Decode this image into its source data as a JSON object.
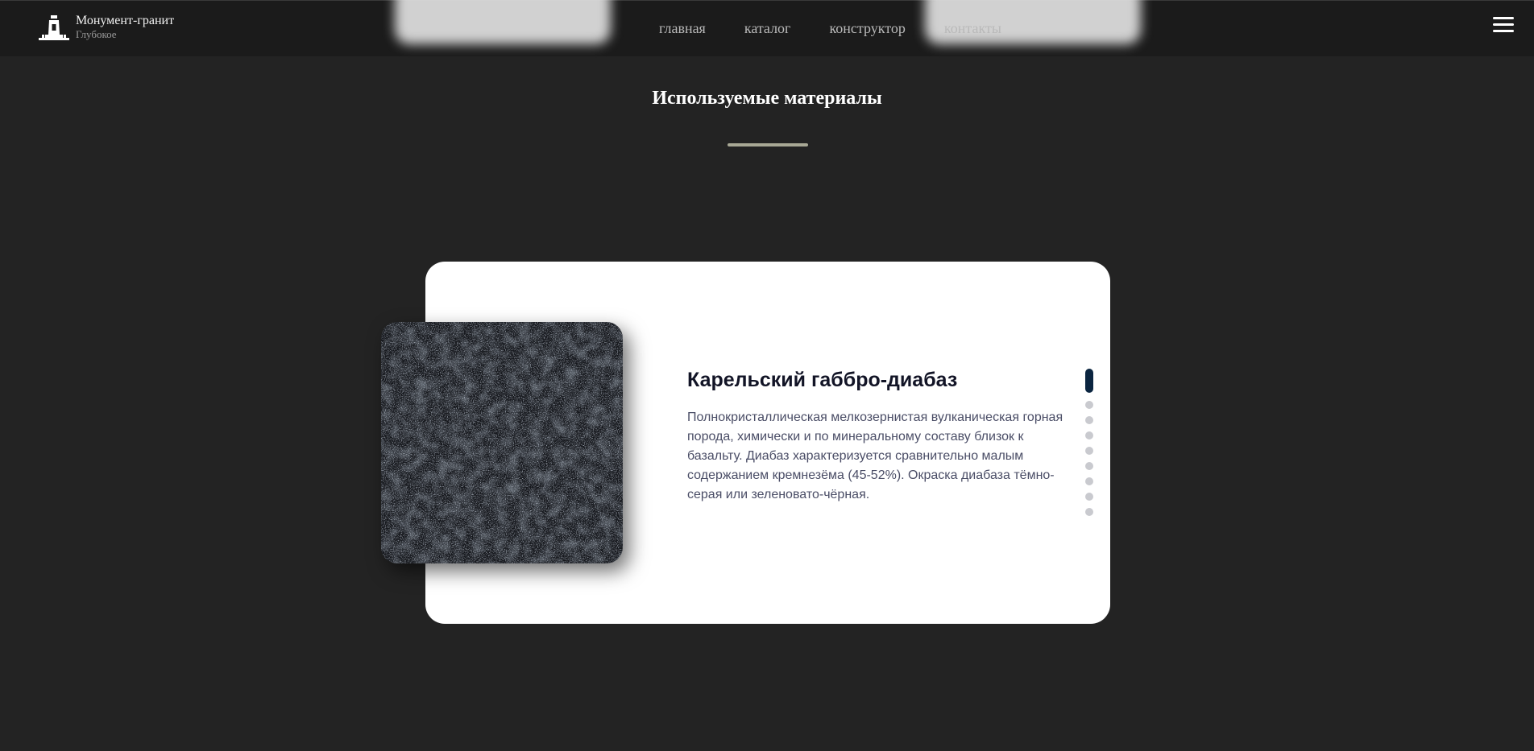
{
  "header": {
    "brand_name": "Монумент-гранит",
    "brand_sub": "Глубокое",
    "nav": [
      "главная",
      "каталог",
      "конструктор",
      "контакты"
    ],
    "menu_icon": "hamburger-icon"
  },
  "section": {
    "title": "Используемые материалы"
  },
  "material": {
    "title": "Карельский габбро-диабаз",
    "description": "Полнокристаллическая мелкозернистая вулканическая горная порода, химически и по минеральному составу близок к базальту. Диабаз характеризуется сравнительно малым содержанием кремнезёма (45-52%). Окраска диабаза тёмно-серая или зеленовато-чёрная.",
    "image": "granite-stone-image"
  },
  "slider": {
    "total": 9,
    "active_index": 0
  },
  "colors": {
    "background": "#232323",
    "header": "#1b1b1b",
    "active_dot": "#0b2540",
    "underline": "#a8a895"
  }
}
